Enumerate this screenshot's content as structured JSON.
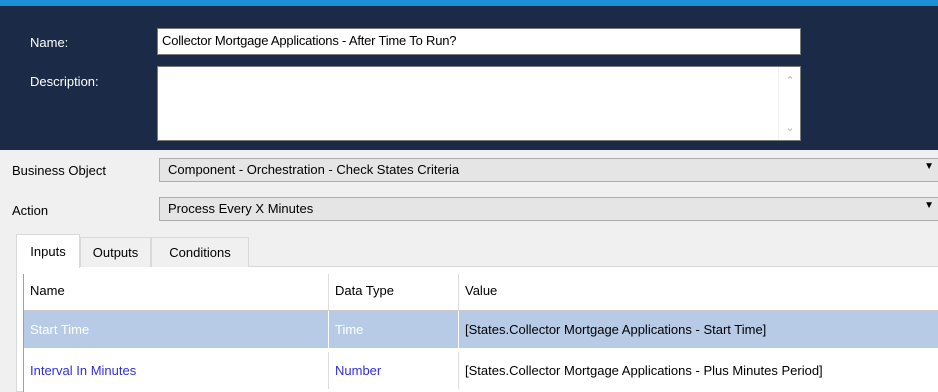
{
  "header": {
    "name_label": "Name:",
    "name_value": "Collector Mortgage Applications  - After Time To Run?",
    "description_label": "Description:",
    "description_value": ""
  },
  "fields": {
    "business_object_label": "Business Object",
    "business_object_value": "Component - Orchestration - Check States Criteria",
    "action_label": "Action",
    "action_value": "Process Every X Minutes"
  },
  "tabs": [
    {
      "label": "Inputs",
      "active": true
    },
    {
      "label": "Outputs",
      "active": false
    },
    {
      "label": "Conditions",
      "active": false
    }
  ],
  "grid": {
    "columns": [
      "Name",
      "Data Type",
      "Value"
    ],
    "rows": [
      {
        "name": "Start Time",
        "data_type": "Time",
        "value": "[States.Collector Mortgage Applications - Start Time]",
        "selected": true
      },
      {
        "name": "Interval In Minutes",
        "data_type": "Number",
        "value": "[States.Collector Mortgage Applications - Plus Minutes Period]",
        "selected": false
      }
    ]
  },
  "colors": {
    "header_bg": "#1b2a47",
    "accent_border": "#1c8fd6",
    "selected_row": "#b7cbe6",
    "link_text": "#2f2fe0"
  }
}
